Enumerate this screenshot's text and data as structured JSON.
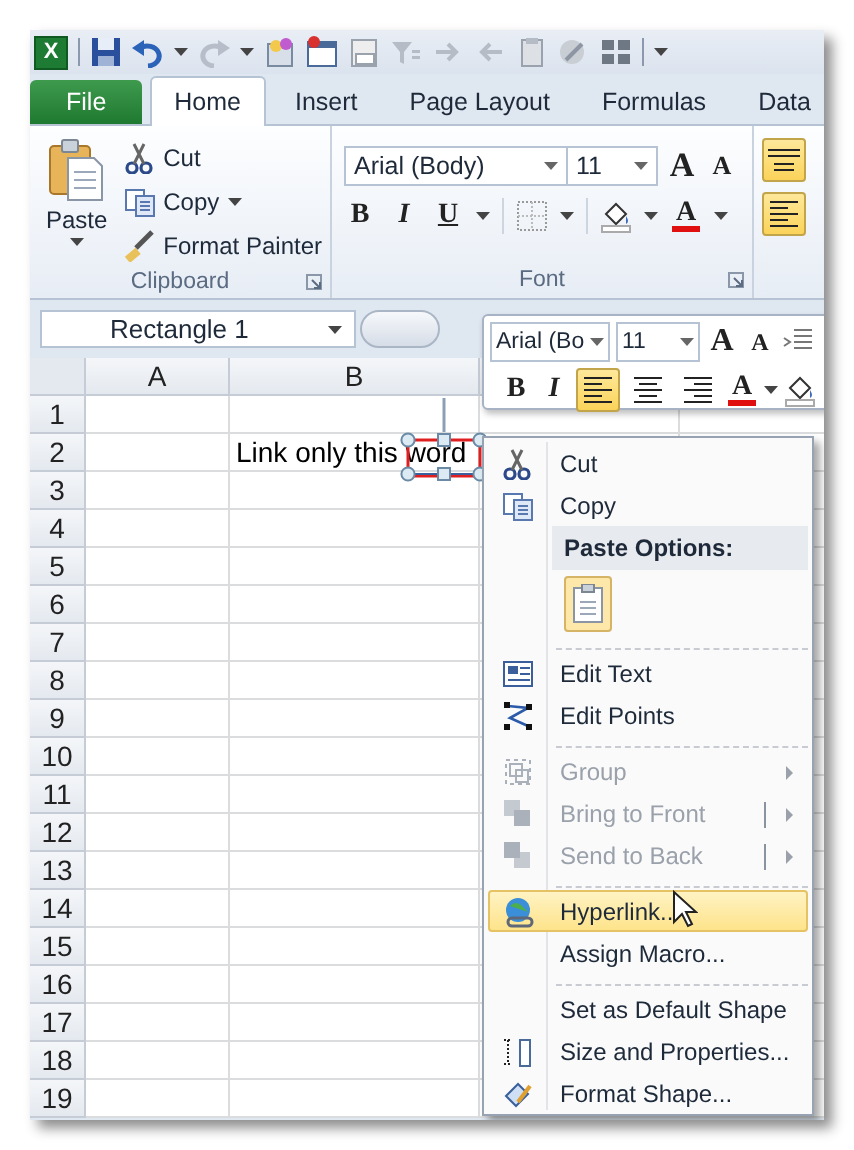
{
  "app_logo": "X",
  "tabs": [
    {
      "label": "File",
      "kind": "file",
      "selected": false
    },
    {
      "label": "Home",
      "kind": "tab",
      "selected": true
    },
    {
      "label": "Insert",
      "kind": "tab",
      "selected": false
    },
    {
      "label": "Page Layout",
      "kind": "tab",
      "selected": false
    },
    {
      "label": "Formulas",
      "kind": "tab",
      "selected": false
    },
    {
      "label": "Data",
      "kind": "tab",
      "selected": false
    }
  ],
  "clipboard": {
    "label": "Clipboard",
    "paste": "Paste",
    "cut": "Cut",
    "copy": "Copy",
    "format_painter": "Format Painter"
  },
  "font_group": {
    "label": "Font",
    "font": "Arial (Body)",
    "size": "11",
    "grow": "A",
    "shrink": "A",
    "bold": "B",
    "italic": "I",
    "underline": "U",
    "font_color": "A"
  },
  "alignment": {
    "buttons": [
      {
        "selected": true
      },
      {
        "selected": true
      }
    ]
  },
  "name_box": "Rectangle 1",
  "sheet": {
    "columns": [
      "A",
      "B"
    ],
    "rows": [
      "1",
      "2",
      "3",
      "4",
      "5",
      "6",
      "7",
      "8",
      "9",
      "10",
      "11",
      "12",
      "13",
      "14",
      "15",
      "16",
      "17",
      "18",
      "19"
    ],
    "cell_b2": "Link only this word"
  },
  "mini_toolbar": {
    "font": "Arial (Bo",
    "size": "11",
    "grow": "A",
    "shrink": "A",
    "bold": "B",
    "italic": "I",
    "font_color": "A",
    "align_buttons": [
      {
        "selected": true
      },
      {
        "selected": false
      },
      {
        "selected": false
      }
    ]
  },
  "context_menu": {
    "items": [
      {
        "kind": "command",
        "label": "Cut",
        "disabled": false,
        "selected": false,
        "submenu": false,
        "split": false
      },
      {
        "kind": "command",
        "label": "Copy",
        "disabled": false,
        "selected": false,
        "submenu": false,
        "split": false
      },
      {
        "kind": "header",
        "label": "Paste Options:"
      },
      {
        "kind": "paste-options"
      },
      {
        "kind": "separator"
      },
      {
        "kind": "command",
        "label": "Edit Text",
        "disabled": false,
        "selected": false,
        "submenu": false,
        "split": false
      },
      {
        "kind": "command",
        "label": "Edit Points",
        "disabled": false,
        "selected": false,
        "submenu": false,
        "split": false
      },
      {
        "kind": "separator"
      },
      {
        "kind": "command",
        "label": "Group",
        "disabled": true,
        "selected": false,
        "submenu": true,
        "split": false
      },
      {
        "kind": "command",
        "label": "Bring to Front",
        "disabled": true,
        "selected": false,
        "submenu": true,
        "split": true
      },
      {
        "kind": "command",
        "label": "Send to Back",
        "disabled": true,
        "selected": false,
        "submenu": true,
        "split": true
      },
      {
        "kind": "separator"
      },
      {
        "kind": "command",
        "label": "Hyperlink...",
        "disabled": false,
        "selected": true,
        "submenu": false,
        "split": false
      },
      {
        "kind": "command",
        "label": "Assign Macro...",
        "disabled": false,
        "selected": false,
        "submenu": false,
        "split": false
      },
      {
        "kind": "separator"
      },
      {
        "kind": "command",
        "label": "Set as Default Shape",
        "disabled": false,
        "selected": false,
        "submenu": false,
        "split": false
      },
      {
        "kind": "command",
        "label": "Size and Properties...",
        "disabled": false,
        "selected": false,
        "submenu": false,
        "split": false
      },
      {
        "kind": "command",
        "label": "Format Shape...",
        "disabled": false,
        "selected": false,
        "submenu": false,
        "split": false
      }
    ]
  }
}
